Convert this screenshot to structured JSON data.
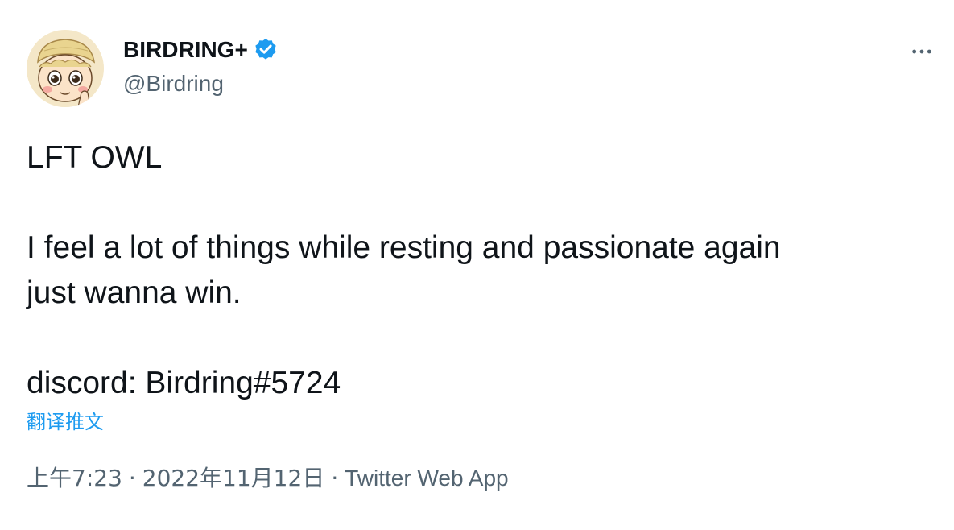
{
  "author": {
    "display_name": "BIRDRING+",
    "handle": "@Birdring",
    "verified": true,
    "avatar_icon": "cartoon-avatar-icon"
  },
  "tweet": {
    "text": "LFT OWL\n\nI feel a lot of things while resting and passionate again\njust wanna win.\n\ndiscord: Birdring#5724",
    "translate_label": "翻译推文",
    "time": "上午7:23",
    "date": "2022年11月12日",
    "separator": "·",
    "source": "Twitter Web App"
  },
  "icons": {
    "verified": "verified-badge-icon",
    "more": "more-options-icon"
  },
  "colors": {
    "accent": "#1d9bf0",
    "text_primary": "#0f1419",
    "text_secondary": "#536471",
    "divider": "#eff3f4"
  }
}
